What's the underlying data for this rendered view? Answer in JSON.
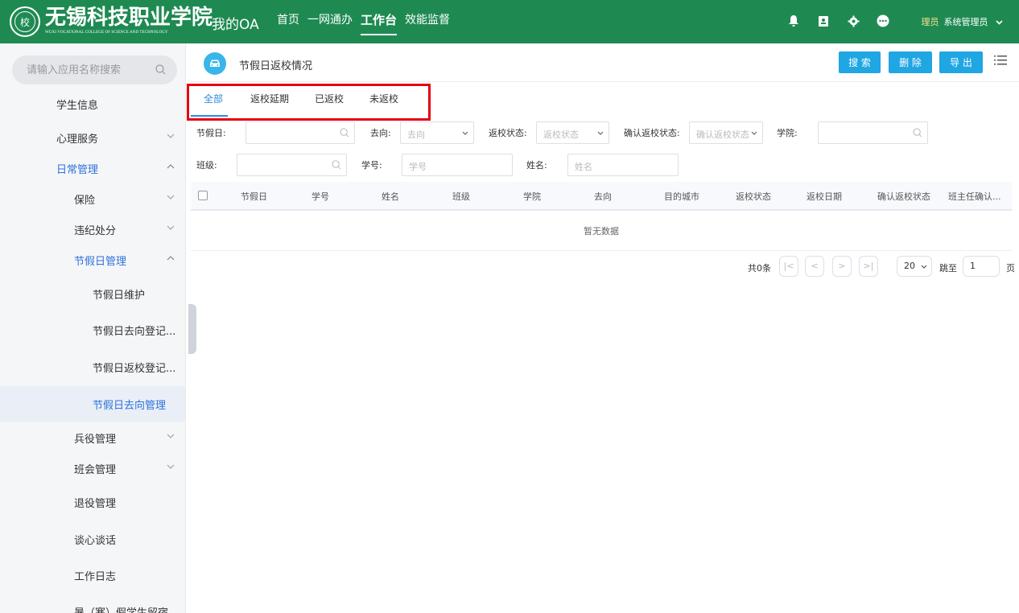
{
  "header": {
    "logo_glyph": "校",
    "school_name": "无锡科技职业学院",
    "school_name_en": "WUXI VOCATIONAL COLLEGE OF SCIENCE AND TECHNOLOGY",
    "my_oa": "我的OA",
    "nav": [
      {
        "label": "首页",
        "active": false
      },
      {
        "label": "一网通办",
        "active": false
      },
      {
        "label": "工作台",
        "active": true
      },
      {
        "label": "效能监督",
        "active": false
      }
    ],
    "icons": [
      "bell-icon",
      "contacts-icon",
      "settings-icon",
      "more-icon"
    ],
    "user_role": "理员",
    "user_name": "系统管理员"
  },
  "sidebar": {
    "search_placeholder": "请输入应用名称搜索",
    "items": [
      {
        "label": "学生信息"
      },
      {
        "label": "心理服务"
      },
      {
        "label": "日常管理"
      },
      {
        "label": "保险"
      },
      {
        "label": "违纪处分"
      },
      {
        "label": "节假日管理"
      },
      {
        "label": "节假日维护"
      },
      {
        "label": "节假日去向登记..."
      },
      {
        "label": "节假日返校登记..."
      },
      {
        "label": "节假日去向管理"
      },
      {
        "label": "兵役管理"
      },
      {
        "label": "班会管理"
      },
      {
        "label": "退役管理"
      },
      {
        "label": "谈心谈话"
      },
      {
        "label": "工作日志"
      },
      {
        "label": "暑（寒）假学生留宿"
      }
    ]
  },
  "page": {
    "title": "节假日返校情况",
    "buttons": {
      "search": "搜 索",
      "delete": "删 除",
      "export": "导 出"
    },
    "tabs": [
      "全部",
      "返校延期",
      "已返校",
      "未返校"
    ],
    "filters": {
      "holiday_label": "节假日:",
      "destination_label": "去向:",
      "destination_placeholder": "去向",
      "return_status_label": "返校状态:",
      "return_status_placeholder": "返校状态",
      "confirm_status_label": "确认返校状态:",
      "confirm_status_placeholder": "确认返校状态",
      "college_label": "学院:",
      "class_label": "班级:",
      "student_no_label": "学号:",
      "student_no_placeholder": "学号",
      "name_label": "姓名:",
      "name_placeholder": "姓名"
    },
    "table": {
      "columns": [
        "节假日",
        "学号",
        "姓名",
        "班级",
        "学院",
        "去向",
        "目的城市",
        "返校状态",
        "返校日期",
        "确认返校状态",
        "班主任确认..."
      ],
      "empty_text": "暂无数据"
    },
    "pager": {
      "total": "共0条",
      "page_size": "20",
      "goto_label": "跳至",
      "goto_value": "1",
      "page_label": "页"
    }
  }
}
